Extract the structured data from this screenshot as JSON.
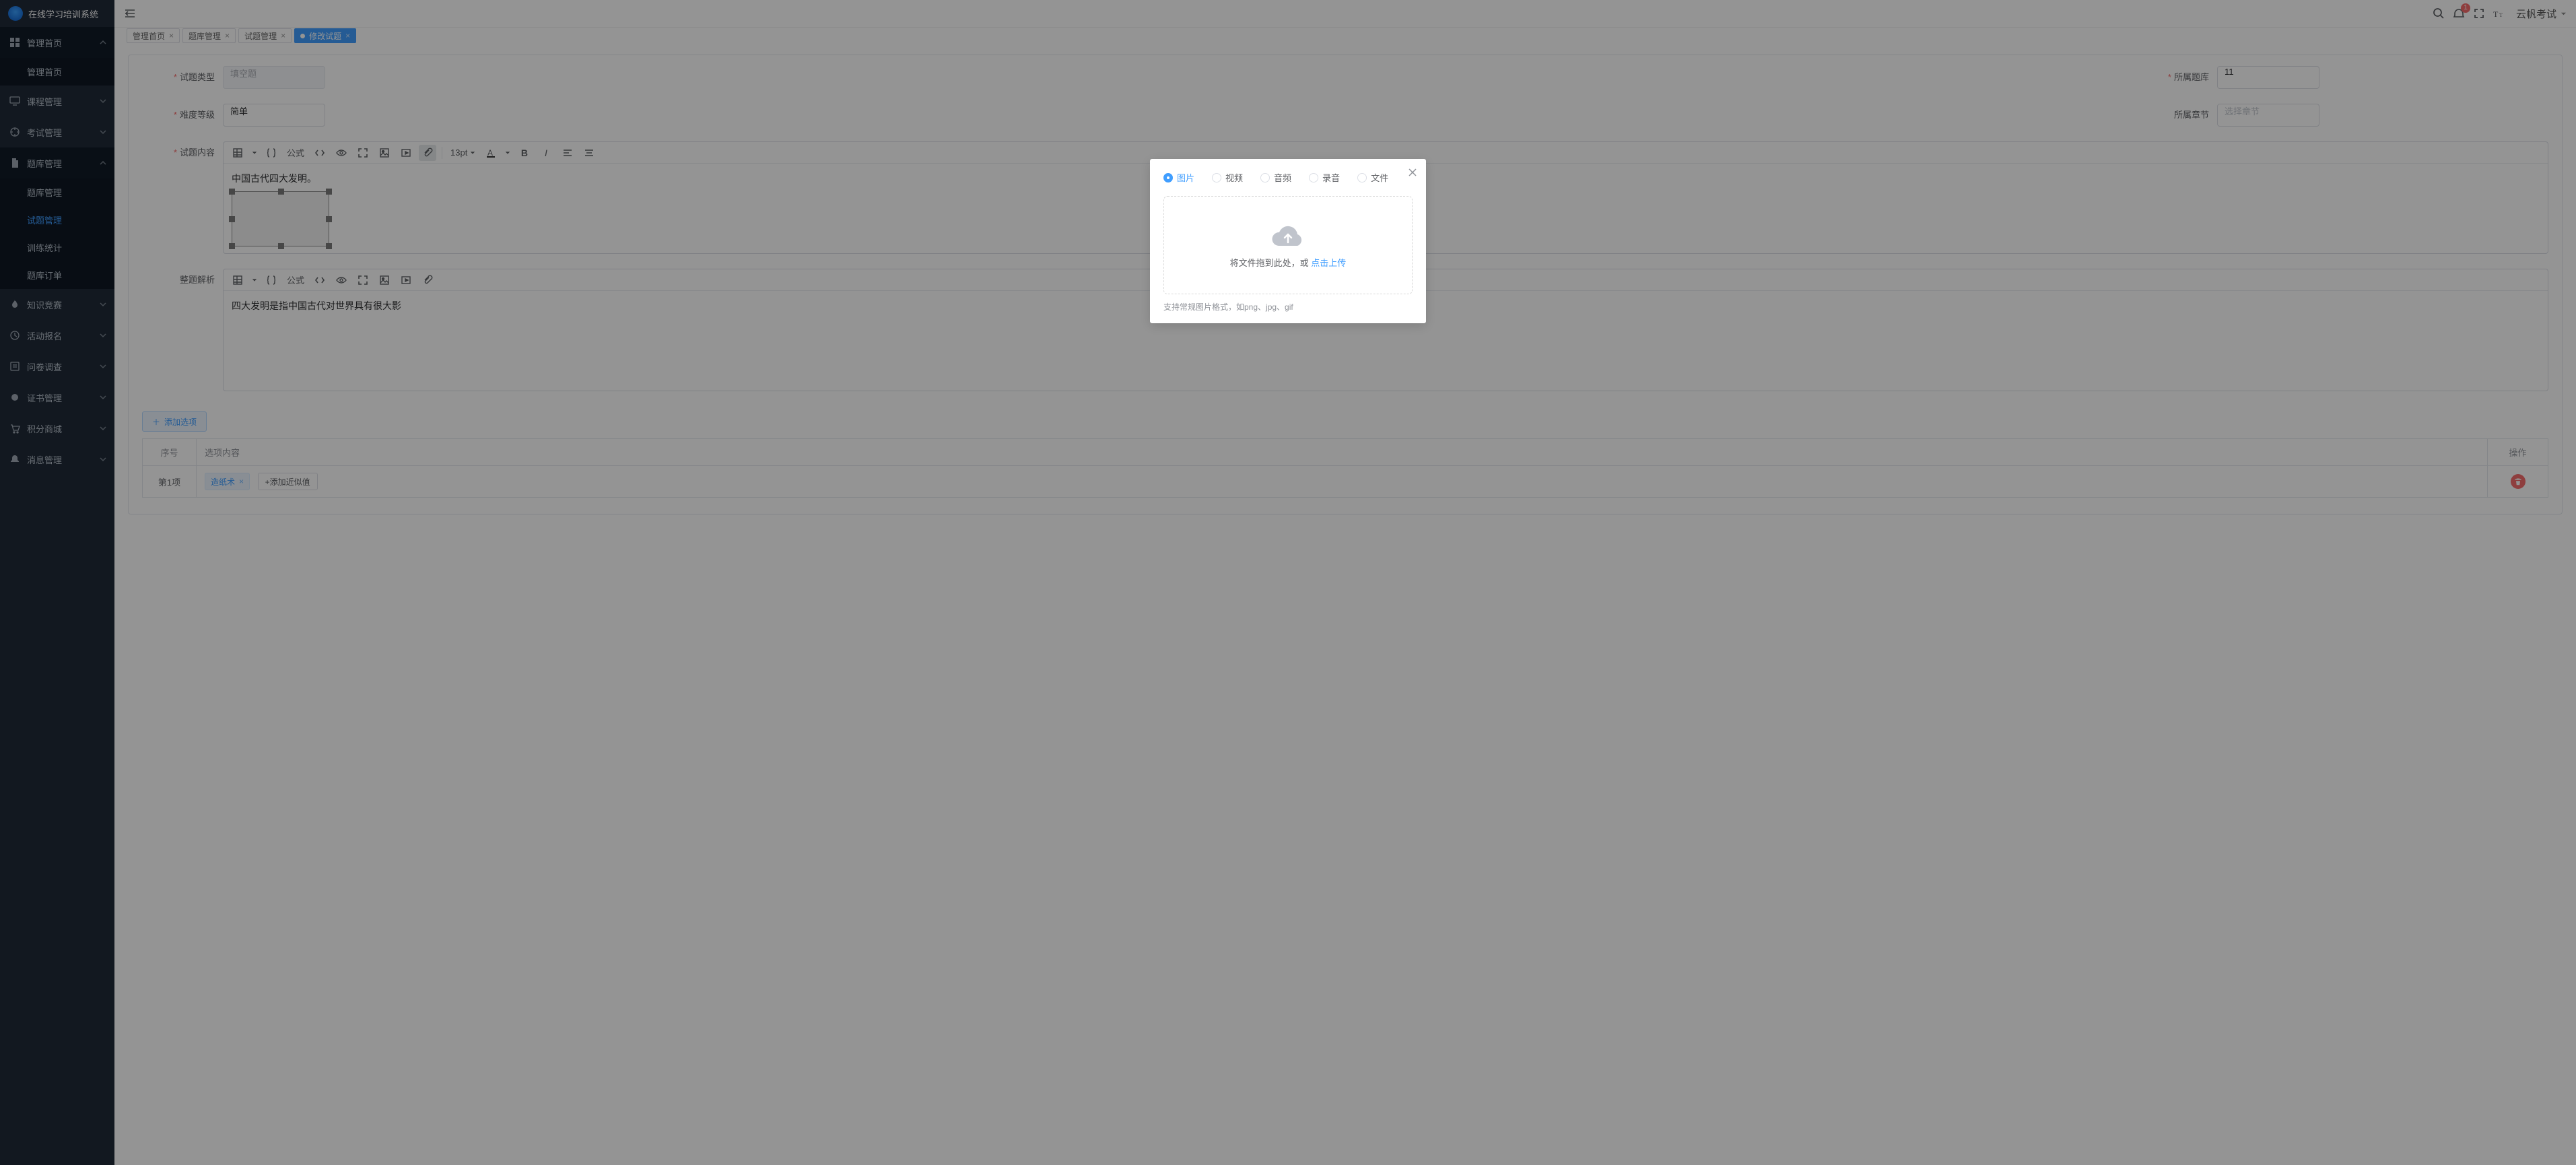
{
  "brand": "在线学习培训系统",
  "user": {
    "name": "云帆考试",
    "notifications": "1"
  },
  "sidebar": {
    "items": [
      {
        "label": "管理首页",
        "expanded": true,
        "children": [
          {
            "label": "管理首页"
          }
        ]
      },
      {
        "label": "课程管理"
      },
      {
        "label": "考试管理"
      },
      {
        "label": "题库管理",
        "expanded": true,
        "children": [
          {
            "label": "题库管理"
          },
          {
            "label": "试题管理",
            "active": true
          },
          {
            "label": "训练统计"
          },
          {
            "label": "题库订单"
          }
        ]
      },
      {
        "label": "知识竞赛"
      },
      {
        "label": "活动报名"
      },
      {
        "label": "问卷调查"
      },
      {
        "label": "证书管理"
      },
      {
        "label": "积分商城"
      },
      {
        "label": "消息管理"
      }
    ]
  },
  "tabs": [
    {
      "label": "管理首页"
    },
    {
      "label": "题库管理"
    },
    {
      "label": "试题管理"
    },
    {
      "label": "修改试题",
      "active": true
    }
  ],
  "form": {
    "type_label": "试题类型",
    "type_value": "填空题",
    "bank_label": "所属题库",
    "bank_value": "11",
    "difficulty_label": "难度等级",
    "difficulty_value": "简单",
    "chapter_label": "所属章节",
    "chapter_placeholder": "选择章节",
    "content_label": "试题内容",
    "analysis_label": "整题解析",
    "content_text": "中国古代四大发明。",
    "analysis_text": "四大发明是指中国古代对世界具有很大影",
    "font_size": "13pt",
    "formula_btn": "公式"
  },
  "options": {
    "add_label": "添加选项",
    "columns": {
      "index": "序号",
      "content": "选项内容",
      "action": "操作"
    },
    "rows": [
      {
        "index": "第1项",
        "tag": "造纸术",
        "add_similar": "+添加近似值"
      }
    ]
  },
  "dialog": {
    "tabs": [
      {
        "label": "图片",
        "checked": true
      },
      {
        "label": "视频"
      },
      {
        "label": "音频"
      },
      {
        "label": "录音"
      },
      {
        "label": "文件"
      }
    ],
    "upload_hint_prefix": "将文件拖到此处，或 ",
    "upload_hint_link": "点击上传",
    "support": "支持常规图片格式，如png、jpg、gif"
  }
}
